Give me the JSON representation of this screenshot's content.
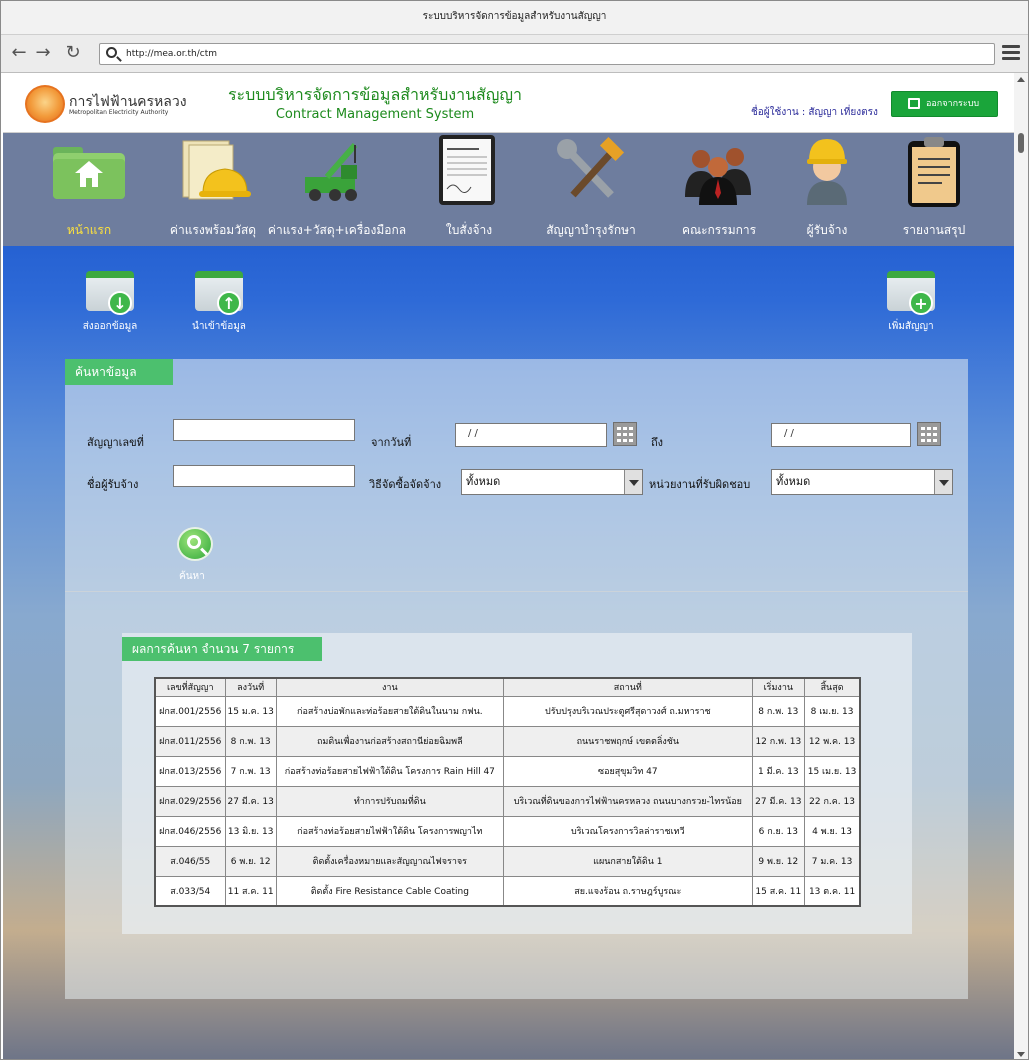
{
  "browser": {
    "window_title": "ระบบบริหารจัดการข้อมูลสำหรับงานสัญญา",
    "url": "http://mea.or.th/ctm"
  },
  "header": {
    "org_th": "การไฟฟ้านครหลวง",
    "org_en": "Metropolitan Electricity Authority",
    "system_th": "ระบบบริหารจัดการข้อมูลสำหรับงานสัญญา",
    "system_en": "Contract Management System",
    "user_label": "ชื่อผู้ใช้งาน : สัญญา เที่ยงตรง",
    "logout_label": "ออกจากระบบ"
  },
  "menu": {
    "items": [
      {
        "label": "หน้าแรก",
        "icon": "home-folder-icon",
        "active": true
      },
      {
        "label": "ค่าแรงพร้อมวัสดุ",
        "icon": "papers-helmet-icon"
      },
      {
        "label": "ค่าแรง+วัสดุ+เครื่องมือกล",
        "icon": "crane-truck-icon"
      },
      {
        "label": "ใบสั่งจ้าง",
        "icon": "contract-document-icon"
      },
      {
        "label": "สัญญาบำรุงรักษา",
        "icon": "tools-icon"
      },
      {
        "label": "คณะกรรมการ",
        "icon": "committee-people-icon"
      },
      {
        "label": "ผู้รับจ้าง",
        "icon": "worker-helmet-icon"
      },
      {
        "label": "รายงานสรุป",
        "icon": "clipboard-report-icon"
      }
    ]
  },
  "actions": {
    "export_label": "ส่งออกข้อมูล",
    "import_label": "นำเข้าข้อมูล",
    "add_label": "เพิ่มสัญญา"
  },
  "search": {
    "tab_label": "ค้นหาข้อมูล",
    "contract_no_label": "สัญญาเลขที่",
    "contract_no_value": "",
    "from_date_label": "จากวันที่",
    "from_date_value": "/ /",
    "to_label": "ถึง",
    "to_date_value": "/ /",
    "contractor_label": "ชื่อผู้รับจ้าง",
    "contractor_value": "",
    "method_label": "วิธีจัดซื้อจัดจ้าง",
    "method_value": "ทั้งหมด",
    "unit_label": "หน่วยงานที่รับผิดชอบ",
    "unit_value": "ทั้งหมด",
    "search_button_label": "ค้นหา"
  },
  "results": {
    "title": "ผลการค้นหา จำนวน 7 รายการ",
    "columns": [
      "เลขที่สัญญา",
      "ลงวันที่",
      "งาน",
      "สถานที่",
      "เริ่มงาน",
      "สิ้นสุด"
    ],
    "rows": [
      [
        "ฝกส.001/2556",
        "15 ม.ค. 13",
        "ก่อสร้างบ่อพักและท่อร้อยสายใต้ดินในนาม กฟน.",
        "ปรับปรุงบริเวณประตูศรีสุดาวงศ์ ถ.มหาราช",
        "8 ก.พ. 13",
        "8 เม.ย. 13"
      ],
      [
        "ฝกส.011/2556",
        "8 ก.พ. 13",
        "ถมดินเพื่องานก่อสร้างสถานีย่อยฉิมพลี",
        "ถนนราชพฤกษ์ เขตตลิ่งชัน",
        "12 ก.พ. 13",
        "12 พ.ค. 13"
      ],
      [
        "ฝกส.013/2556",
        "7 ก.พ. 13",
        "ก่อสร้างท่อร้อยสายไฟฟ้าใต้ดิน โครงการ Rain Hill 47",
        "ซอยสุขุมวิท 47",
        "1 มี.ค. 13",
        "15 เม.ย. 13"
      ],
      [
        "ฝกส.029/2556",
        "27 มี.ค. 13",
        "ทำการปรับถมที่ดิน",
        "บริเวณที่ดินของการไฟฟ้านครหลวง ถนนบางกรวย-ไทรน้อย",
        "27 มี.ค. 13",
        "22 ก.ค. 13"
      ],
      [
        "ฝกส.046/2556",
        "13 มิ.ย. 13",
        "ก่อสร้างท่อร้อยสายไฟฟ้าใต้ดิน โครงการพญาไท",
        "บริเวณโครงการวิลล่าราชเทวี",
        "6 ก.ย. 13",
        "4 พ.ย. 13"
      ],
      [
        "ส.046/55",
        "6 พ.ย. 12",
        "ติดตั้งเครื่องหมายและสัญญาณไฟจราจร",
        "แผนกสายใต้ดิน 1",
        "9 พ.ย. 12",
        "7 ม.ค. 13"
      ],
      [
        "ส.033/54",
        "11 ส.ค. 11",
        "ติดตั้ง Fire Resistance Cable Coating",
        "สย.แจงร้อน ถ.ราษฎร์บูรณะ",
        "15 ส.ค. 11",
        "13 ต.ค. 11"
      ]
    ]
  }
}
